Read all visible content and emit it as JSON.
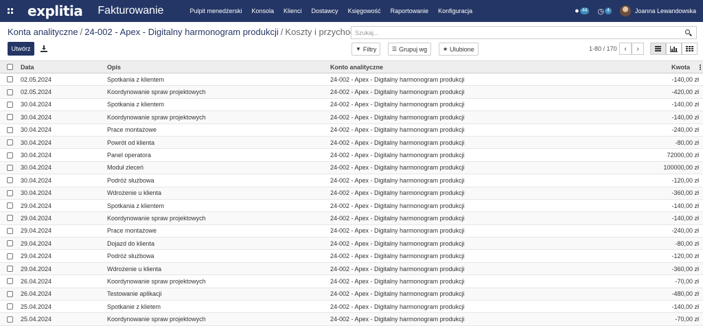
{
  "navbar": {
    "logo": "explitia",
    "app_name": "Fakturowanie",
    "menu": [
      "Pulpit menedżerski",
      "Konsola",
      "Klienci",
      "Dostawcy",
      "Księgowość",
      "Raportowanie",
      "Konfiguracja"
    ],
    "messages_count": "44",
    "activities_count": "4",
    "user_name": "Joanna Lewandowska"
  },
  "breadcrumb": {
    "root": "Konta analityczne",
    "account": "24-002 - Apex - Digitalny harmonogram produkcji",
    "current": "Koszty i przychody"
  },
  "search": {
    "placeholder": "Szukaj..."
  },
  "toolbar": {
    "create_label": "Utwórz",
    "filters_label": "Filtry",
    "group_by_label": "Grupuj wg",
    "favorites_label": "Ulubione",
    "pager": "1-80 / 170"
  },
  "table": {
    "columns": {
      "date": "Data",
      "description": "Opis",
      "account": "Konto analityczne",
      "amount": "Kwota"
    },
    "rows": [
      {
        "date": "02.05.2024",
        "description": "Spotkania z klientem",
        "account": "24-002 - Apex - Digitalny harmonogram produkcji",
        "amount": "-140,00 zł"
      },
      {
        "date": "02.05.2024",
        "description": "Koordynowanie spraw projektowych",
        "account": "24-002 - Apex - Digitalny harmonogram produkcji",
        "amount": "-420,00 zł"
      },
      {
        "date": "30.04.2024",
        "description": "Spotkania z klientem",
        "account": "24-002 - Apex - Digitalny harmonogram produkcji",
        "amount": "-140,00 zł"
      },
      {
        "date": "30.04.2024",
        "description": "Koordynowanie spraw projektowych",
        "account": "24-002 - Apex - Digitalny harmonogram produkcji",
        "amount": "-140,00 zł"
      },
      {
        "date": "30.04.2024",
        "description": "Prace montażowe",
        "account": "24-002 - Apex - Digitalny harmonogram produkcji",
        "amount": "-240,00 zł"
      },
      {
        "date": "30.04.2024",
        "description": "Powrót od klienta",
        "account": "24-002 - Apex - Digitalny harmonogram produkcji",
        "amount": "-80,00 zł"
      },
      {
        "date": "30.04.2024",
        "description": "Panel operatora",
        "account": "24-002 - Apex - Digitalny harmonogram produkcji",
        "amount": "72000,00 zł"
      },
      {
        "date": "30.04.2024",
        "description": "Moduł zleceń",
        "account": "24-002 - Apex - Digitalny harmonogram produkcji",
        "amount": "100000,00 zł"
      },
      {
        "date": "30.04.2024",
        "description": "Podróż służbowa",
        "account": "24-002 - Apex - Digitalny harmonogram produkcji",
        "amount": "-120,00 zł"
      },
      {
        "date": "30.04.2024",
        "description": "Wdrożenie u klienta",
        "account": "24-002 - Apex - Digitalny harmonogram produkcji",
        "amount": "-360,00 zł"
      },
      {
        "date": "29.04.2024",
        "description": "Spotkania z klientem",
        "account": "24-002 - Apex - Digitalny harmonogram produkcji",
        "amount": "-140,00 zł"
      },
      {
        "date": "29.04.2024",
        "description": "Koordynowanie spraw projektowych",
        "account": "24-002 - Apex - Digitalny harmonogram produkcji",
        "amount": "-140,00 zł"
      },
      {
        "date": "29.04.2024",
        "description": "Prace montażowe",
        "account": "24-002 - Apex - Digitalny harmonogram produkcji",
        "amount": "-240,00 zł"
      },
      {
        "date": "29.04.2024",
        "description": "Dojazd do klienta",
        "account": "24-002 - Apex - Digitalny harmonogram produkcji",
        "amount": "-80,00 zł"
      },
      {
        "date": "29.04.2024",
        "description": "Podróż służbowa",
        "account": "24-002 - Apex - Digitalny harmonogram produkcji",
        "amount": "-120,00 zł"
      },
      {
        "date": "29.04.2024",
        "description": "Wdrożenie u klienta",
        "account": "24-002 - Apex - Digitalny harmonogram produkcji",
        "amount": "-360,00 zł"
      },
      {
        "date": "26.04.2024",
        "description": "Koordynowanie spraw projektowych",
        "account": "24-002 - Apex - Digitalny harmonogram produkcji",
        "amount": "-70,00 zł"
      },
      {
        "date": "26.04.2024",
        "description": "Testowanie aplikacji",
        "account": "24-002 - Apex - Digitalny harmonogram produkcji",
        "amount": "-480,00 zł"
      },
      {
        "date": "25.04.2024",
        "description": "Spotkanie z klietem",
        "account": "24-002 - Apex - Digitalny harmonogram produkcji",
        "amount": "-140,00 zł"
      },
      {
        "date": "25.04.2024",
        "description": "Koordynowanie spraw projektowych",
        "account": "24-002 - Apex - Digitalny harmonogram produkcji",
        "amount": "-70,00 zł"
      }
    ]
  }
}
